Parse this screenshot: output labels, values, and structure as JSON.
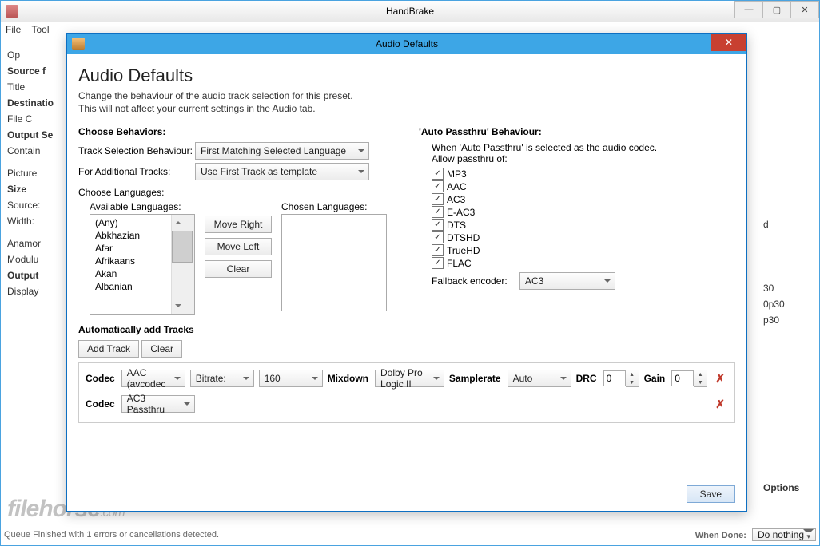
{
  "main": {
    "title": "HandBrake",
    "menu": [
      "File",
      "Tool"
    ],
    "bg": {
      "open": "Op",
      "source": "Source  f",
      "title": "Title",
      "dest": "Destinatio",
      "file": "File   C",
      "output": "Output Se",
      "contain": "Contain",
      "tab": "Picture",
      "size": "Size",
      "srclbl": "Source:",
      "width": "Width:",
      "anam": "Anamor",
      "modul": "Modulu",
      "out": "Output",
      "disp": "Display"
    },
    "bgright": {
      "d": "d",
      "p30": "30",
      "p30b": "0p30",
      "p30c": "p30",
      "opt": "Options"
    },
    "status": "Queue Finished with 1 errors or cancellations detected.",
    "done_lbl": "When Done:",
    "done_val": "Do nothing"
  },
  "dlg": {
    "title": "Audio Defaults",
    "heading": "Audio Defaults",
    "sub1": "Change the behaviour of the audio track selection for this preset.",
    "sub2": "This will not affect your current settings in the Audio tab.",
    "behaviors": "Choose Behaviors:",
    "tsb_lbl": "Track Selection Behaviour:",
    "tsb_val": "First Matching Selected Language",
    "fat_lbl": "For Additional Tracks:",
    "fat_val": "Use First Track as template",
    "langs": "Choose Languages:",
    "avail": "Available Languages:",
    "chosen": "Chosen Languages:",
    "lang_items": [
      "(Any)",
      "Abkhazian",
      "Afar",
      "Afrikaans",
      "Akan",
      "Albanian"
    ],
    "mv_r": "Move Right",
    "mv_l": "Move Left",
    "mv_c": "Clear",
    "passthru": "'Auto Passthru' Behaviour:",
    "pass_note": "When 'Auto Passthru' is selected as the audio codec.",
    "pass_allow": "Allow passthru of:",
    "codecs": [
      "MP3",
      "AAC",
      "AC3",
      "E-AC3",
      "DTS",
      "DTSHD",
      "TrueHD",
      "FLAC"
    ],
    "fb_lbl": "Fallback encoder:",
    "fb_val": "AC3",
    "auto": "Automatically add Tracks",
    "addtrack": "Add Track",
    "clear": "Clear",
    "t1": {
      "codec": "AAC (avcodec",
      "bitrate_lbl": "Bitrate:",
      "bitrate": "160",
      "mix_lbl": "Mixdown",
      "mix": "Dolby Pro Logic II",
      "sr_lbl": "Samplerate",
      "sr": "Auto",
      "drc_lbl": "DRC",
      "drc": "0",
      "gain_lbl": "Gain",
      "gain": "0"
    },
    "t2": {
      "codec": "AC3 Passthru"
    },
    "codec_lbl": "Codec",
    "save": "Save"
  },
  "watermark": {
    "a": "filehorse",
    "b": ".com"
  }
}
